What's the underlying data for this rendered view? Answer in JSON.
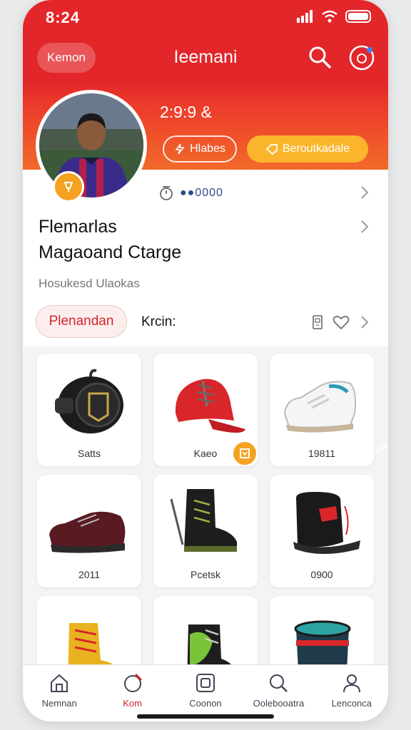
{
  "status_bar": {
    "time": "8:24"
  },
  "header": {
    "back_label": "Kemon",
    "title": "Ieemani",
    "search_icon": "search-icon",
    "notification_icon": "notification-icon"
  },
  "profile": {
    "stat": "2:9:9 &",
    "outline_button": "Hlabes",
    "yellow_button": "Beroutkadale",
    "meta": "●●0000",
    "name_line1": "Flemarlas",
    "name_line2": "Magaoand Ctarge",
    "subtitle": "Hosukesd Ulaokas",
    "tag_pill": "Plenandan",
    "tag_label": "Krcin:"
  },
  "products": [
    {
      "caption": "Satts",
      "icon": "helmet-bag-icon"
    },
    {
      "caption": "Kaeo",
      "icon": "red-cap-icon"
    },
    {
      "caption": "19811",
      "icon": "white-sneaker-icon"
    },
    {
      "caption": "2011",
      "icon": "dark-shoe-icon"
    },
    {
      "caption": "Pcetsk",
      "icon": "black-boot-icon"
    },
    {
      "caption": "0900",
      "icon": "black-hat-icon"
    },
    {
      "caption": "",
      "icon": "yellow-boot-icon"
    },
    {
      "caption": "",
      "icon": "green-boot-icon"
    },
    {
      "caption": "",
      "icon": "bucket-icon"
    }
  ],
  "tabbar": [
    {
      "label": "Nemnan",
      "icon": "home-icon"
    },
    {
      "label": "Kom",
      "icon": "shop-icon"
    },
    {
      "label": "Coonon",
      "icon": "box-icon"
    },
    {
      "label": "Oolebooatra",
      "icon": "search-icon"
    },
    {
      "label": "Lenconca",
      "icon": "profile-icon"
    }
  ],
  "colors": {
    "brand_red": "#e3262a",
    "accent_yellow": "#fbb52c",
    "badge_orange": "#f4a21f"
  }
}
